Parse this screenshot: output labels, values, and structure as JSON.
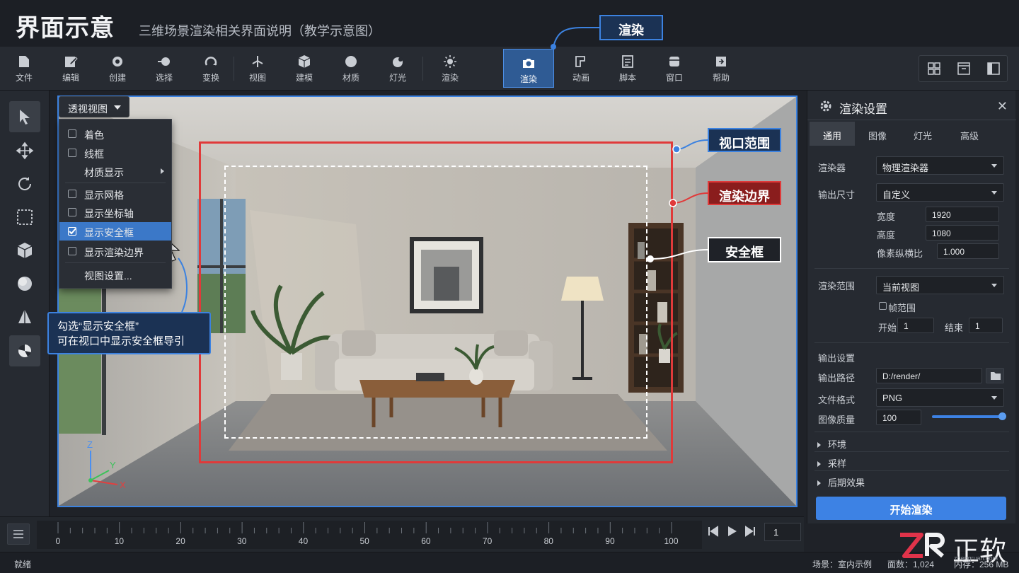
{
  "title": {
    "main": "界面示意",
    "subtitle": "三维场景渲染相关界面说明（教学示意图）"
  },
  "callouts": {
    "top": "渲染",
    "viewport": "视口范围",
    "render_bounds": "渲染边界",
    "safe_frame": "安全框"
  },
  "toolbar": {
    "items": [
      {
        "label": "文件",
        "icon": "file-icon"
      },
      {
        "label": "编辑",
        "icon": "edit-icon"
      },
      {
        "label": "创建",
        "icon": "create-icon"
      },
      {
        "label": "选择",
        "icon": "select-icon"
      },
      {
        "label": "变换",
        "icon": "transform-icon"
      },
      {
        "label": "视图",
        "icon": "view-icon"
      },
      {
        "label": "建模",
        "icon": "cube-icon"
      },
      {
        "label": "材质",
        "icon": "sphere-icon"
      },
      {
        "label": "灯光",
        "icon": "light-icon"
      },
      {
        "label": "渲染",
        "icon": "sun-icon"
      },
      {
        "label": "渲染",
        "icon": "camera-icon",
        "active": true
      },
      {
        "label": "动画",
        "icon": "animation-icon"
      },
      {
        "label": "脚本",
        "icon": "script-icon"
      },
      {
        "label": "窗口",
        "icon": "window-icon"
      },
      {
        "label": "帮助",
        "icon": "help-icon"
      }
    ]
  },
  "viewport": {
    "view_dropdown": "透视视图",
    "menu": [
      {
        "label": "着色",
        "checked": false
      },
      {
        "label": "线框",
        "checked": false
      },
      {
        "label": "材质显示",
        "submenu": true
      },
      {
        "label": "显示网格",
        "checked": false
      },
      {
        "label": "显示坐标轴",
        "checked": false
      },
      {
        "label": "显示安全框",
        "checked": true
      },
      {
        "label": "显示渲染边界",
        "checked": false
      },
      {
        "label": "视图设置..."
      }
    ],
    "hint_line1": "勾选“显示安全框”",
    "hint_line2": "可在视口中显示安全框导引",
    "axes": {
      "z": "Z",
      "y": "Y",
      "x": "X"
    }
  },
  "render_panel": {
    "title": "渲染设置",
    "tabs": [
      "通用",
      "图像",
      "灯光",
      "高级"
    ],
    "active_tab": "通用",
    "renderer_label": "渲染器",
    "renderer_value": "物理渲染器",
    "output_size_label": "输出尺寸",
    "output_size_value": "自定义",
    "width_label": "宽度",
    "width_value": "1920",
    "height_label": "高度",
    "height_value": "1080",
    "aspect_label": "像素纵横比",
    "aspect_value": "1.000",
    "range_label": "渲染范围",
    "range_value": "当前视图",
    "frame_range_label": "帧范围",
    "start_label": "开始",
    "start_value": "1",
    "end_label": "结束",
    "end_value": "1",
    "output_settings_label": "输出设置",
    "output_path_label": "输出路径",
    "output_path_value": "D:/render/",
    "format_label": "文件格式",
    "format_value": "PNG",
    "quality_label": "图像质量",
    "quality_value": "100",
    "sections": [
      "环境",
      "采样",
      "后期效果"
    ],
    "start_button": "开始渲染"
  },
  "timeline": {
    "ticks": [
      "0",
      "10",
      "20",
      "30",
      "40",
      "50",
      "60",
      "70",
      "80",
      "90",
      "100"
    ],
    "current_frame": "1"
  },
  "statusbar": {
    "left": "就绪",
    "scene": "场景：室内示例",
    "faces": "面数：1,024",
    "memory": "内存：256 MB"
  },
  "watermark": {
    "letters": "ZR",
    "chinese": "正软",
    "url": "zhengruan.com"
  },
  "colors": {
    "accent": "#3c82e0",
    "render_bounds": "#e03a3a",
    "safe_frame": "#ffffff"
  }
}
